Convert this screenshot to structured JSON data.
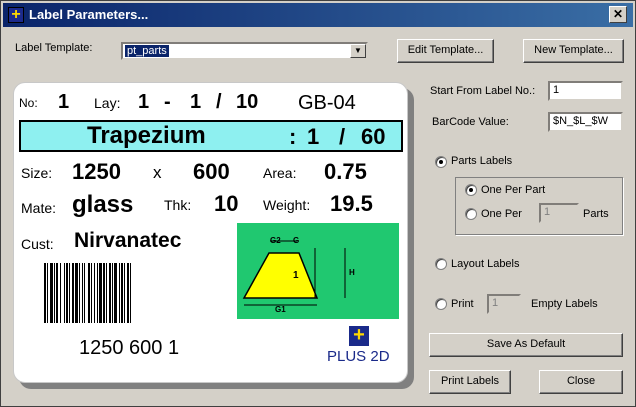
{
  "window": {
    "title": "Label Parameters..."
  },
  "template": {
    "label": "Label Template:",
    "value": "pt_parts"
  },
  "buttons": {
    "edit_template": "Edit Template...",
    "new_template": "New Template...",
    "save_default": "Save As Default",
    "print_labels": "Print Labels",
    "close": "Close"
  },
  "fields": {
    "start_label": "Start From Label No.:",
    "start_value": "1",
    "barcode_label": "BarCode Value:",
    "barcode_value": "$N_$L_$W"
  },
  "options": {
    "parts_labels": "Parts Labels",
    "one_per_part": "One Per Part",
    "one_per": "One Per",
    "one_per_value": "1",
    "parts_suffix": "Parts",
    "layout_labels": "Layout Labels",
    "print": "Print",
    "print_value": "1",
    "empty_labels": "Empty Labels",
    "selected_main": "Parts Labels",
    "selected_sub": "One Per Part"
  },
  "preview": {
    "no_label": "No:",
    "no_value": "1",
    "lay_label": "Lay:",
    "lay_a": "1",
    "lay_dash": "-",
    "lay_b": "1",
    "lay_slash": "/",
    "lay_c": "10",
    "code": "GB-04",
    "shape_name": "Trapezium",
    "count_colon": ":",
    "count_a": "1",
    "count_slash": "/",
    "count_b": "60",
    "size_label": "Size:",
    "size_w": "1250",
    "size_x": "x",
    "size_h": "600",
    "area_label": "Area:",
    "area_value": "0.75",
    "mate_label": "Mate:",
    "mate_value": "glass",
    "thk_label": "Thk:",
    "thk_value": "10",
    "weight_label": "Weight:",
    "weight_value": "19.5",
    "cust_label": "Cust:",
    "cust_value": "Nirvanatec",
    "barcode_text": "1250 600 1",
    "diagram_g2": "G2",
    "diagram_g": "G",
    "diagram_h": "H",
    "diagram_g1": "G1",
    "diagram_num": "1",
    "logo_text": "PLUS 2D",
    "logo_glyph": "+"
  }
}
